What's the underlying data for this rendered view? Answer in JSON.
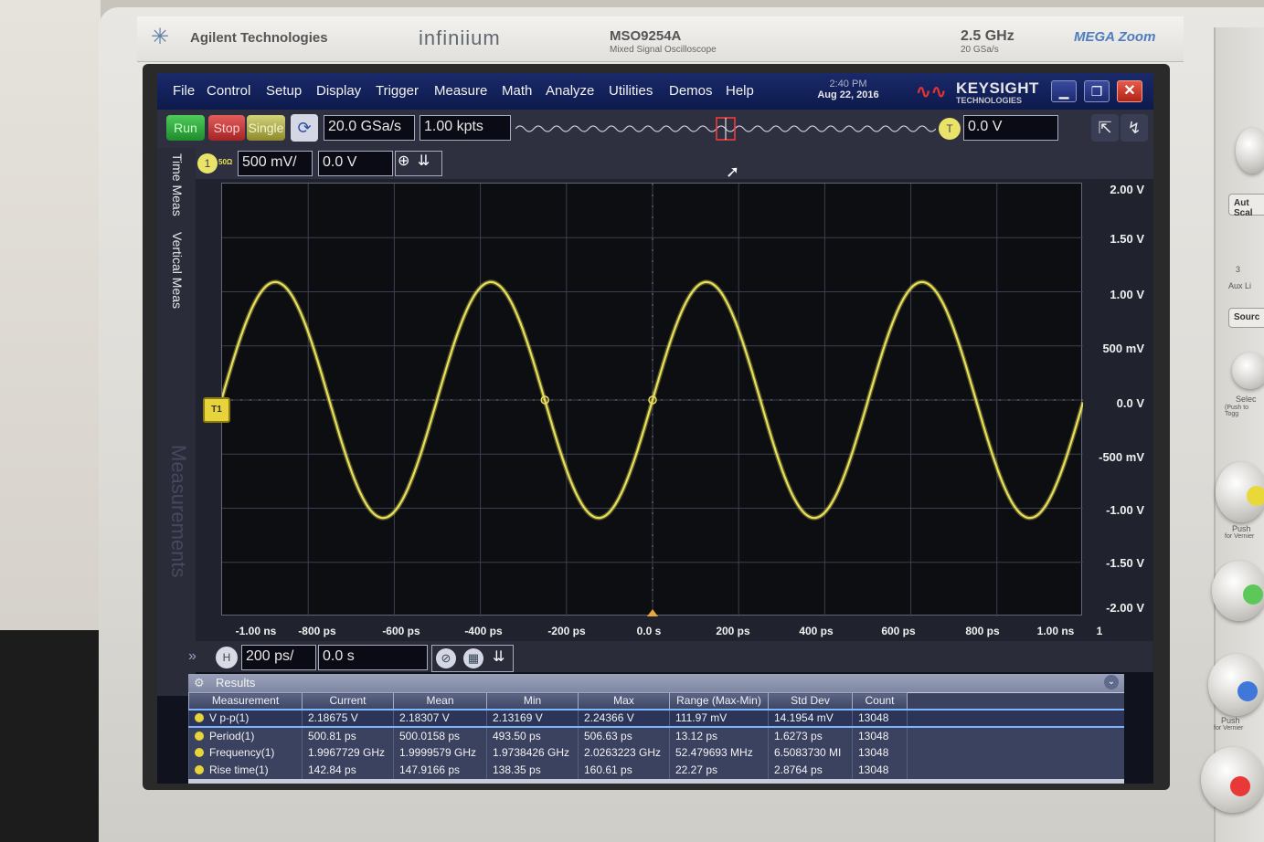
{
  "instrument": {
    "brand": "Agilent Technologies",
    "series": "infiniium",
    "model": "MSO9254A",
    "model_desc": "Mixed Signal Oscilloscope",
    "bandwidth": "2.5 GHz",
    "max_rate": "20 GSa/s",
    "megazoom": "MEGA Zoom"
  },
  "menubar": {
    "items": [
      "File",
      "Control",
      "Setup",
      "Display",
      "Trigger",
      "Measure",
      "Math",
      "Analyze",
      "Utilities",
      "Demos",
      "Help"
    ],
    "time": "2:40 PM",
    "date": "Aug 22, 2016",
    "logo_main": "KEYSIGHT",
    "logo_sub": "TECHNOLOGIES",
    "close_glyph": "✕"
  },
  "toolbar": {
    "run": "Run",
    "stop": "Stop",
    "single": "Single",
    "sample_rate": "20.0 GSa/s",
    "memory_depth": "1.00 kpts",
    "trigger_badge": "T",
    "trigger_level": "0.0 V"
  },
  "channel": {
    "number": "1",
    "impedance": "50Ω",
    "scale": "500 mV/",
    "offset": "0.0 V",
    "marker": "T1"
  },
  "sidetabs": {
    "time_meas": "Time Meas",
    "vertical_meas": "Vertical Meas",
    "measurements": "Measurements"
  },
  "horizontal": {
    "badge": "H",
    "scale": "200 ps/",
    "position": "0.0 s"
  },
  "plot": {
    "y_labels": [
      "2.00 V",
      "1.50 V",
      "1.00 V",
      "500 mV",
      "0.0 V",
      "-500 mV",
      "-1.00 V",
      "-1.50 V",
      "-2.00 V"
    ],
    "x_labels": [
      "-1.00 ns",
      "-800 ps",
      "-600 ps",
      "-400 ps",
      "-200 ps",
      "0.0 s",
      "200 ps",
      "400 ps",
      "600 ps",
      "800 ps",
      "1.00 ns"
    ],
    "x_index": "1",
    "waveform_color": "#e8e05a",
    "waveform": {
      "amplitude_v": 1.09,
      "period_ps": 500.81,
      "x_range_ps": [
        -1000,
        1000
      ]
    }
  },
  "results": {
    "title": "Results",
    "headers": [
      "Measurement",
      "Current",
      "Mean",
      "Min",
      "Max",
      "Range (Max-Min)",
      "Std Dev",
      "Count"
    ],
    "rows": [
      [
        "V p-p(1)",
        "2.18675 V",
        "2.18307 V",
        "2.13169 V",
        "2.24366 V",
        "111.97 mV",
        "14.1954 mV",
        "13048"
      ],
      [
        "Period(1)",
        "500.81 ps",
        "500.0158 ps",
        "493.50 ps",
        "506.63 ps",
        "13.12 ps",
        "1.6273 ps",
        "13048"
      ],
      [
        "Frequency(1)",
        "1.9967729 GHz",
        "1.9999579 GHz",
        "1.9738426 GHz",
        "2.0263223 GHz",
        "52.479693 MHz",
        "6.5083730 MI",
        "13048"
      ],
      [
        "Rise time(1)",
        "142.84 ps",
        "147.9166 ps",
        "138.35 ps",
        "160.61 ps",
        "22.27 ps",
        "2.8764 ps",
        "13048"
      ]
    ]
  },
  "panel": {
    "auto_scale": "Aut Scal",
    "aux_num": "3",
    "aux": "Aux  Li",
    "source": "Sourc",
    "select": "Selec",
    "select_sub": "(Push to Togg",
    "push": "Push",
    "for_vernier": "for Vernier",
    "led_colors": [
      "#e8d83a",
      "#5cc85a",
      "#3f78d8",
      "#e83838"
    ]
  }
}
